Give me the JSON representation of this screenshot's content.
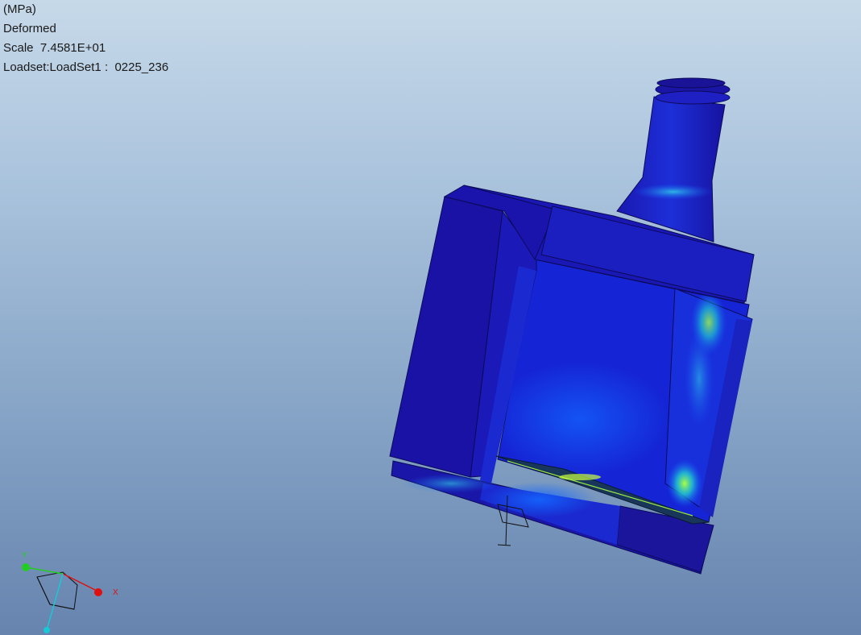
{
  "result_info": {
    "units": "(MPa)",
    "display_mode": "Deformed",
    "scale": "Scale  7.4581E+01",
    "loadset": "Loadset:LoadSet1 :  0225_236"
  },
  "triad": {
    "x_label": "X",
    "y_label": "Y",
    "x_color": "#e01010",
    "y_color": "#22cc22",
    "z_color": "#18c8d8"
  },
  "model": {
    "fringe_colors": [
      "#1a0fa0",
      "#1030d8",
      "#1570ff",
      "#20c0e8",
      "#70ff60",
      "#d8ff30"
    ]
  }
}
